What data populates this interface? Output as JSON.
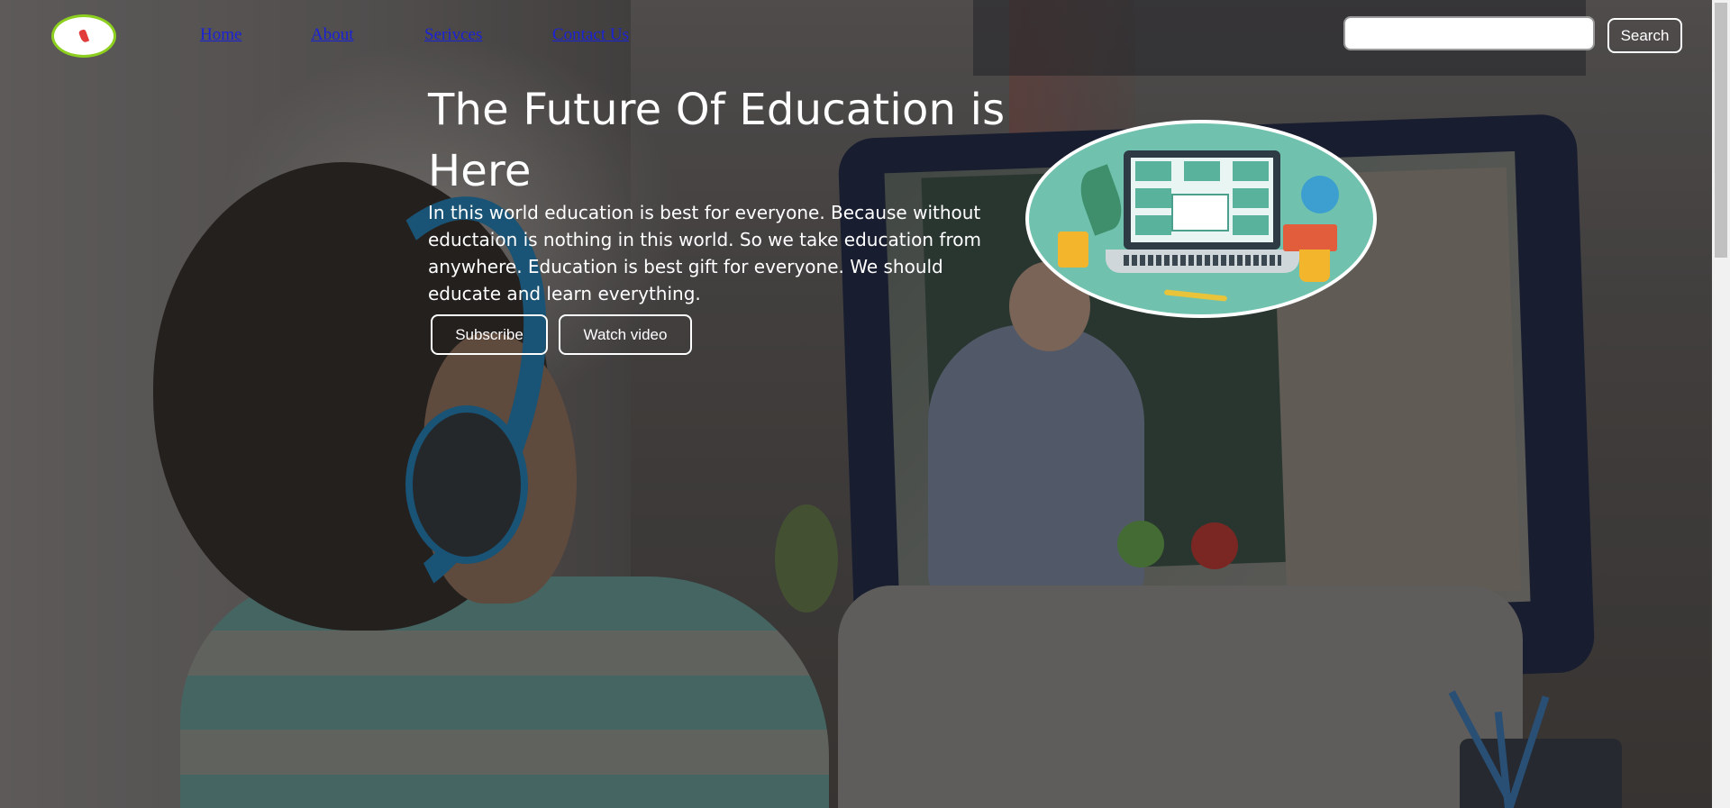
{
  "nav": {
    "logo_alt_text": "ONLINE EDUCATION",
    "links": [
      "Home",
      "About",
      "Serivces",
      "Contact Us"
    ],
    "search": {
      "value": "",
      "placeholder": "",
      "button_label": "Search"
    }
  },
  "hero": {
    "title": "The Future Of Education is Here",
    "paragraph": "In this world education is best for everyone. Because without eductaion is nothing in this world. So we take education from anywhere. Education is best gift for everyone. We should educate and learn everything.",
    "buttons": {
      "subscribe": "Subscribe",
      "watch": "Watch video"
    }
  },
  "colors": {
    "link": "#1a22d6",
    "text": "#ffffff",
    "logo_ring": "#8ccf1e",
    "illustration_bg": "#70c2ae"
  },
  "icons": [
    "online-education-logo-icon",
    "online-class-illustration"
  ]
}
